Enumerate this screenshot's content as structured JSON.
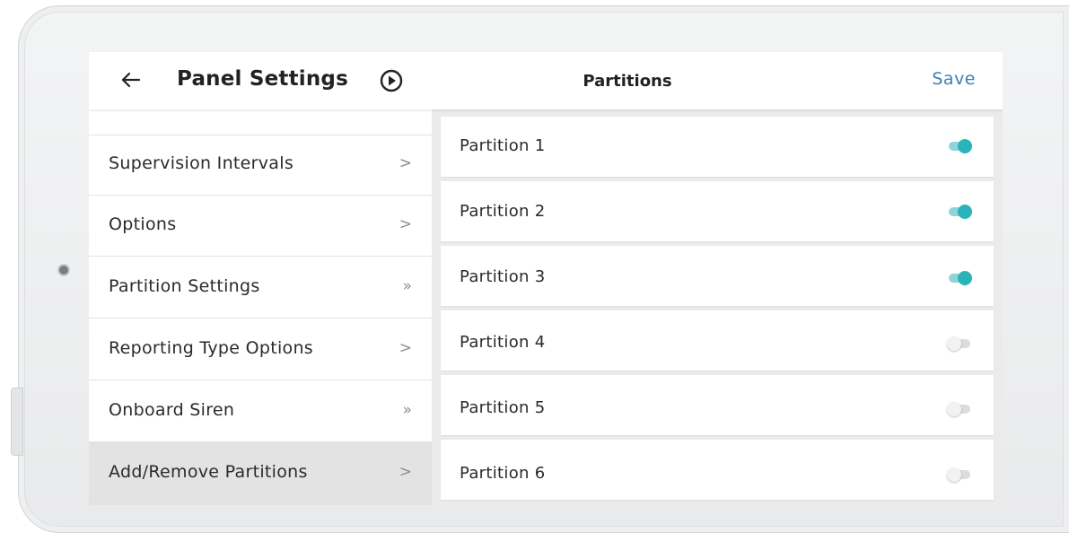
{
  "header": {
    "title": "Panel Settings",
    "page_title": "Partitions",
    "save_label": "Save"
  },
  "sidebar": {
    "items": [
      {
        "label": "Supervision Intervals",
        "chevron": ">"
      },
      {
        "label": "Options",
        "chevron": ">"
      },
      {
        "label": "Partition Settings",
        "chevron": "»"
      },
      {
        "label": "Reporting Type Options",
        "chevron": ">"
      },
      {
        "label": "Onboard Siren",
        "chevron": "»"
      },
      {
        "label": "Add/Remove Partitions",
        "chevron": ">",
        "active": true
      }
    ]
  },
  "partitions": [
    {
      "label": "Partition 1",
      "enabled": true
    },
    {
      "label": "Partition 2",
      "enabled": true
    },
    {
      "label": "Partition 3",
      "enabled": true
    },
    {
      "label": "Partition 4",
      "enabled": false
    },
    {
      "label": "Partition 5",
      "enabled": false
    },
    {
      "label": "Partition 6",
      "enabled": false
    }
  ],
  "colors": {
    "accent": "#2ab3b9",
    "save": "#3a7fb5",
    "active_item": "#e3e3e3"
  },
  "icons": {
    "back": "arrow-left-icon",
    "play": "play-circle-icon"
  }
}
